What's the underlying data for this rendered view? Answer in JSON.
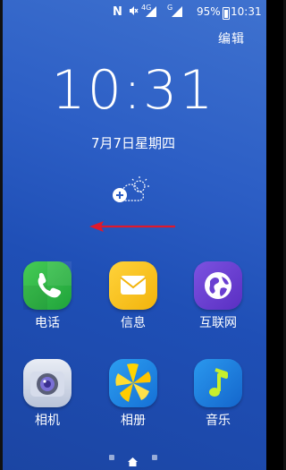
{
  "status_bar": {
    "battery_percent": "95%",
    "time": "10:31",
    "network_4g": "4G",
    "network_g": "G"
  },
  "edit_label": "编辑",
  "clock": {
    "time": "10:31",
    "date": "7月7日星期四"
  },
  "apps": [
    {
      "label": "电话",
      "icon": "phone-icon",
      "color": "#2fb845"
    },
    {
      "label": "信息",
      "icon": "message-icon",
      "color": "#f7c21f"
    },
    {
      "label": "互联网",
      "icon": "internet-icon",
      "color": "#6a3fd1"
    },
    {
      "label": "相机",
      "icon": "camera-icon",
      "color": "#c9d2e6"
    },
    {
      "label": "相册",
      "icon": "gallery-icon",
      "color": "#1e8ae6"
    },
    {
      "label": "音乐",
      "icon": "music-icon",
      "color": "#1f86e0"
    }
  ],
  "page_indicator": {
    "pages": 3,
    "current": 2
  }
}
